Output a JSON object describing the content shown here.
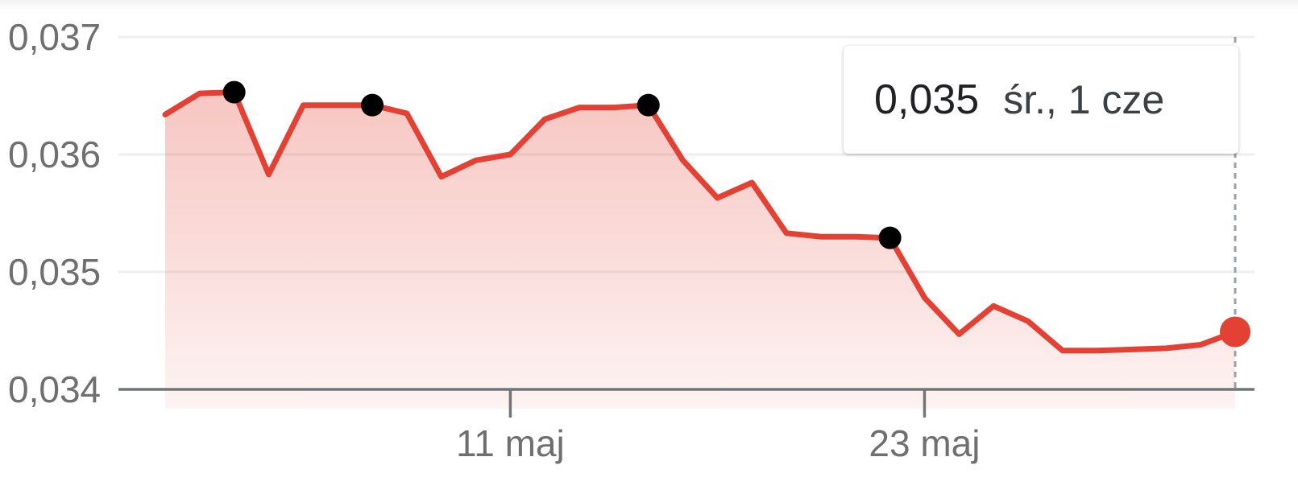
{
  "colors": {
    "line": "#e34133",
    "marker": "#000000",
    "axis": "#70757a",
    "grid": "#eeeeee",
    "tick_label": "#6f6f6f"
  },
  "tooltip": {
    "value": "0,035",
    "date": "śr., 1 cze"
  },
  "chart_data": {
    "type": "area",
    "title": "",
    "xlabel": "",
    "ylabel": "",
    "ylim": [
      0.034,
      0.037
    ],
    "y_ticks": [
      "0,034",
      "0,035",
      "0,036",
      "0,037"
    ],
    "x_tick_labels": [
      {
        "index": 10,
        "label": "11 maj"
      },
      {
        "index": 22,
        "label": "23 maj"
      }
    ],
    "grid": true,
    "legend": "none",
    "series": [
      {
        "values": [
          0.03634,
          0.03652,
          0.03653,
          0.03583,
          0.03642,
          0.03642,
          0.03642,
          0.03635,
          0.03581,
          0.03595,
          0.036,
          0.0363,
          0.0364,
          0.0364,
          0.03642,
          0.03595,
          0.03563,
          0.03576,
          0.03533,
          0.0353,
          0.0353,
          0.03529,
          0.03478,
          0.03447,
          0.03471,
          0.03458,
          0.03433,
          0.03433,
          0.03434,
          0.03435,
          0.03438,
          0.03449
        ],
        "markers": [
          2,
          6,
          14,
          21
        ],
        "highlight_last": true
      }
    ]
  }
}
